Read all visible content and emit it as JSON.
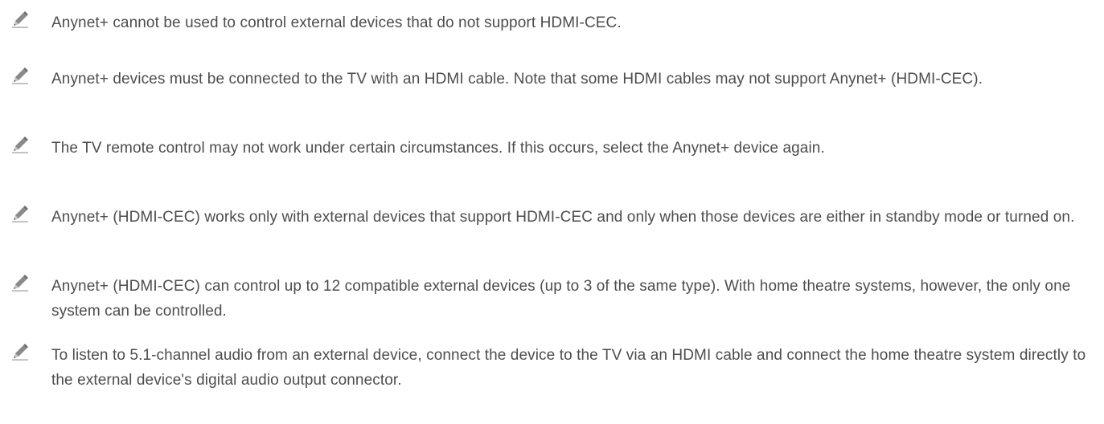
{
  "notes": [
    {
      "icon": "pencil-icon",
      "text": "Anynet+ cannot be used to control external devices that do not support HDMI-CEC."
    },
    {
      "icon": "pencil-icon",
      "text": "Anynet+ devices must be connected to the TV with an HDMI cable. Note that some HDMI cables may not support Anynet+ (HDMI-CEC)."
    },
    {
      "icon": "pencil-icon",
      "text": "The TV remote control may not work under certain circumstances. If this occurs, select the Anynet+ device again."
    },
    {
      "icon": "pencil-icon",
      "text": "Anynet+ (HDMI-CEC) works only with external devices that support HDMI-CEC and only when those devices are either in standby mode or turned on."
    },
    {
      "icon": "pencil-icon",
      "text": "Anynet+ (HDMI-CEC) can control up to 12 compatible external devices (up to 3 of the same type). With home theatre systems, however, the only one system can be controlled."
    },
    {
      "icon": "pencil-icon",
      "text": "To listen to 5.1-channel audio from an external device, connect the device to the TV via an HDMI cable and connect the home theatre system directly to the external device's digital audio output connector."
    }
  ]
}
